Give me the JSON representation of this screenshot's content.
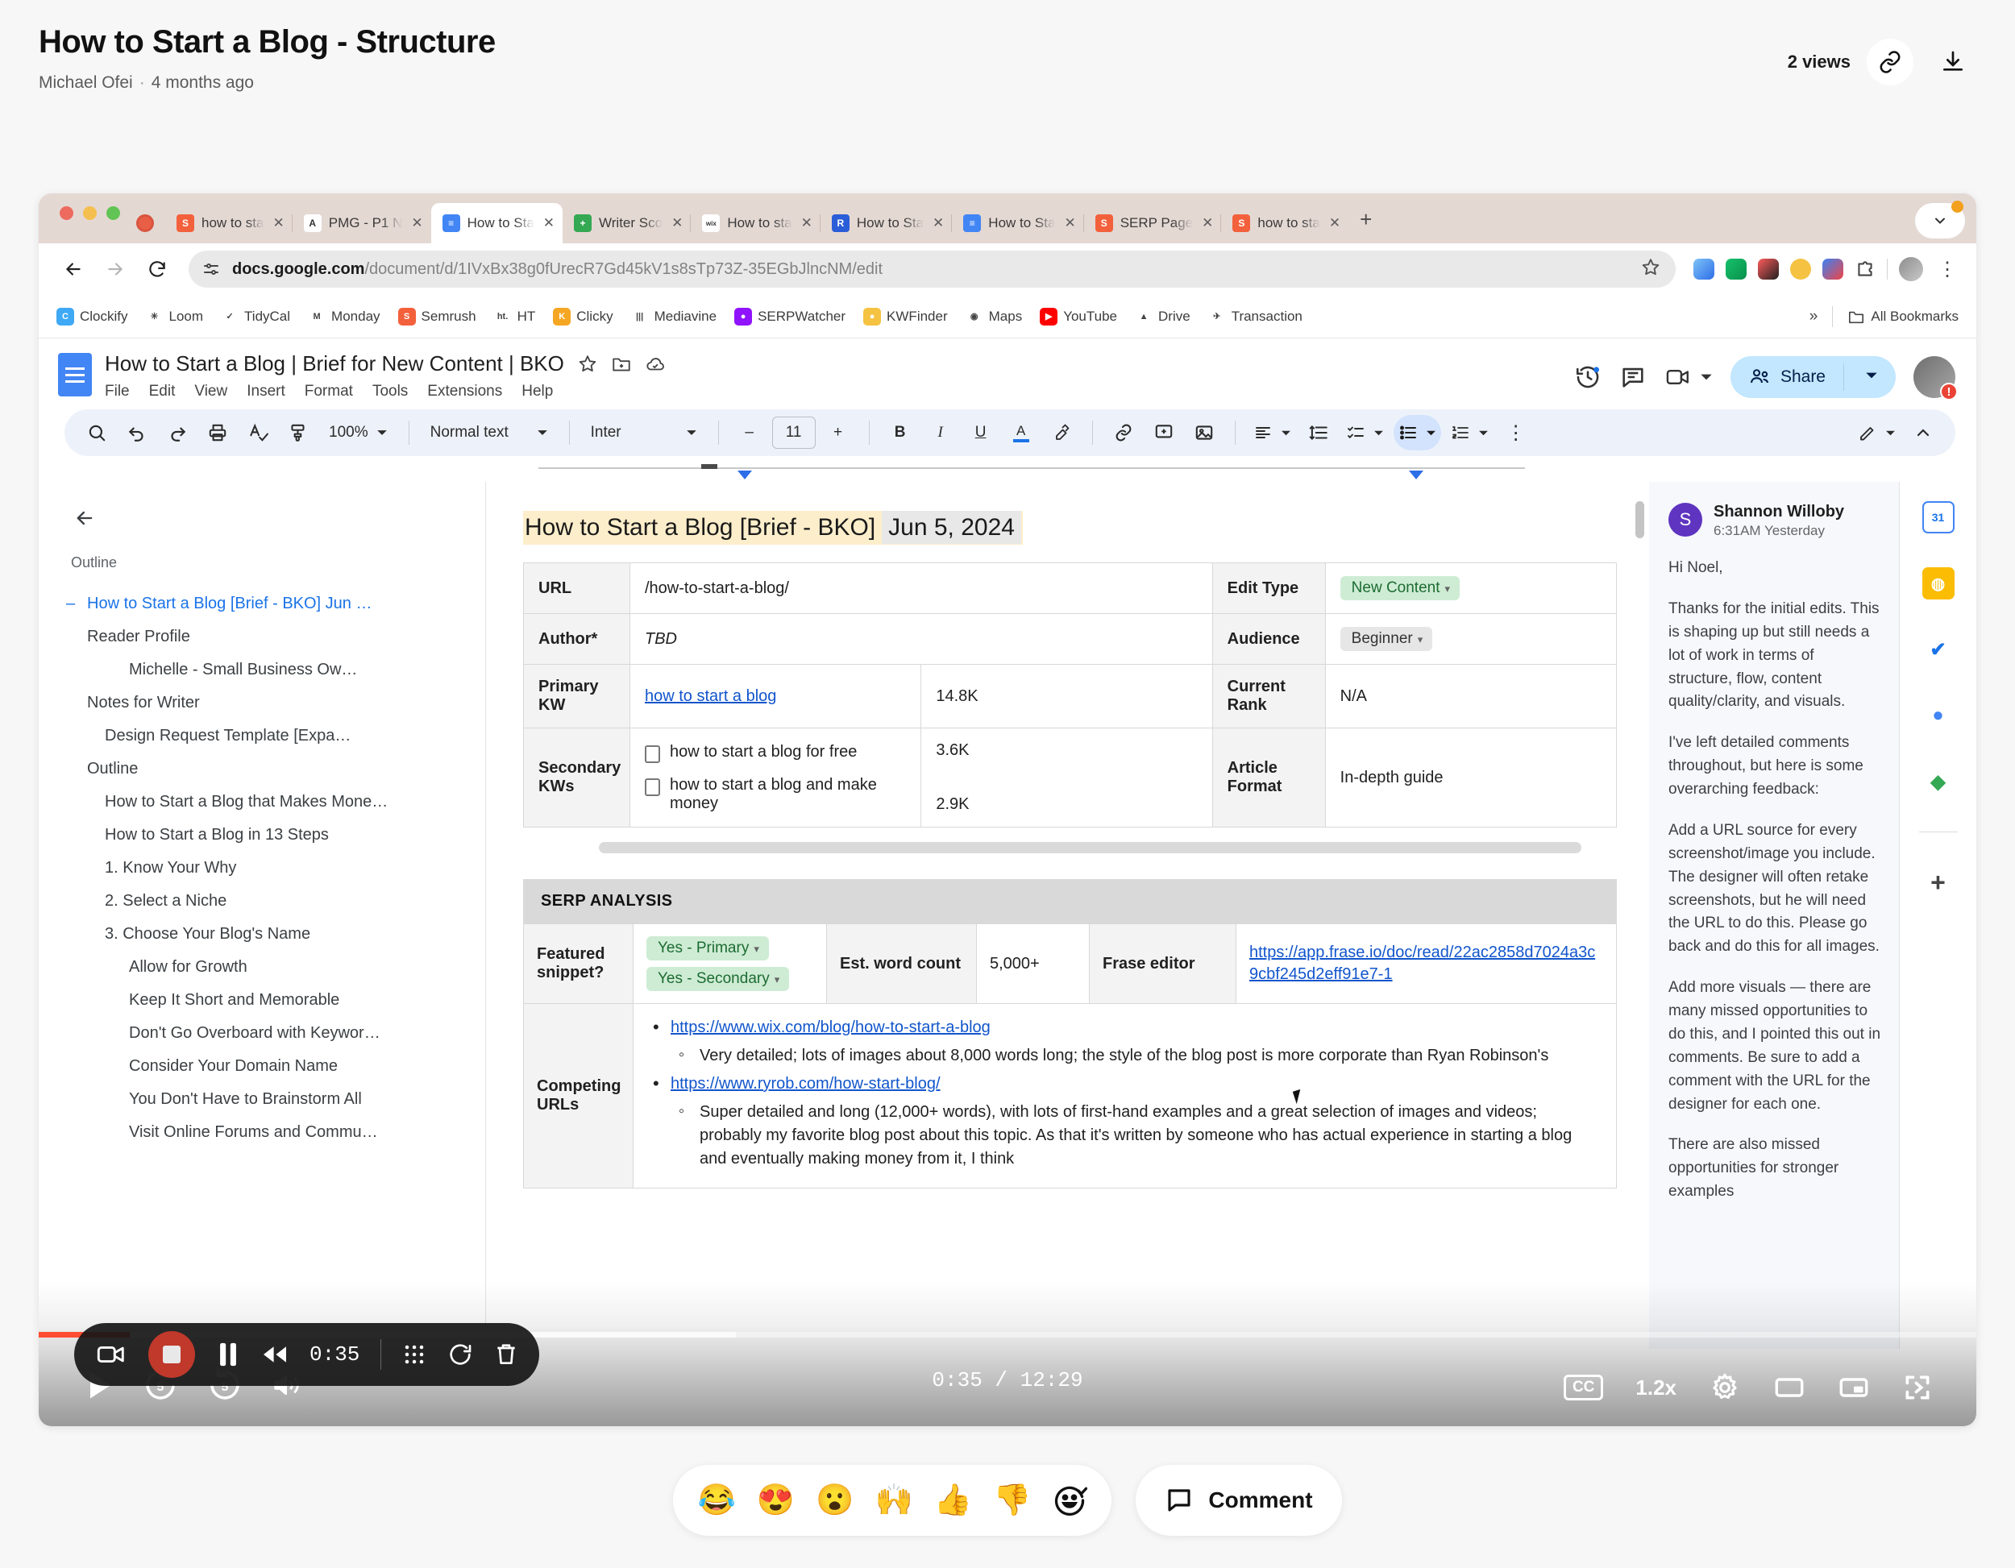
{
  "page": {
    "title": "How to Start a Blog - Structure",
    "author": "Michael Ofei",
    "separator": "·",
    "age": "4 months ago",
    "views": "2 views"
  },
  "browser": {
    "tabs": [
      {
        "label": "how to sta",
        "favicon": "semrush-icon",
        "color": "#f3603c",
        "glyph": "S",
        "active": false
      },
      {
        "label": "PMG - P1 N",
        "favicon": "analytics-icon",
        "color": "#ffffff",
        "glyph": "A",
        "active": false
      },
      {
        "label": "How to Sta",
        "favicon": "google-docs-icon",
        "color": "#4285f4",
        "glyph": "≡",
        "active": true
      },
      {
        "label": "Writer Sco",
        "favicon": "writer-icon",
        "color": "#34a853",
        "glyph": "+",
        "active": false
      },
      {
        "label": "How to sta",
        "favicon": "wix-icon",
        "color": "#ffffff",
        "glyph": "wix",
        "active": false
      },
      {
        "label": "How to Sta",
        "favicon": "reader-icon",
        "color": "#2b5dd8",
        "glyph": "R",
        "active": false
      },
      {
        "label": "How to Sta",
        "favicon": "google-docs-icon",
        "color": "#4285f4",
        "glyph": "≡",
        "active": false
      },
      {
        "label": "SERP Page",
        "favicon": "semrush-icon",
        "color": "#f3603c",
        "glyph": "S",
        "active": false
      },
      {
        "label": "how to sta",
        "favicon": "semrush-icon",
        "color": "#f3603c",
        "glyph": "S",
        "active": false
      }
    ],
    "new_tab_label": "+",
    "close_label": "✕",
    "url_bold": "docs.google.com",
    "url_rest": "/document/d/1IVxBx38g0fUrecR7Gd45kV1s8sTp73Z-35EGbJlncNM/edit",
    "bookmarks": [
      {
        "label": "Clockify",
        "color": "#3fa9f5",
        "glyph": "C"
      },
      {
        "label": "Loom",
        "color": "#ffffff",
        "glyph": "✳"
      },
      {
        "label": "TidyCal",
        "color": "#ffffff",
        "glyph": "✓"
      },
      {
        "label": "Monday",
        "color": "#ffffff",
        "glyph": "M"
      },
      {
        "label": "Semrush",
        "color": "#f3603c",
        "glyph": "S"
      },
      {
        "label": "HT",
        "color": "#ffffff",
        "glyph": "ht."
      },
      {
        "label": "Clicky",
        "color": "#f5a623",
        "glyph": "K"
      },
      {
        "label": "Mediavine",
        "color": "#ffffff",
        "glyph": "|||"
      },
      {
        "label": "SERPWatcher",
        "color": "#9013fe",
        "glyph": "●"
      },
      {
        "label": "KWFinder",
        "color": "#f5c242",
        "glyph": "●"
      },
      {
        "label": "Maps",
        "color": "#ffffff",
        "glyph": "◉"
      },
      {
        "label": "YouTube",
        "color": "#ff0000",
        "glyph": "▶"
      },
      {
        "label": "Drive",
        "color": "#ffffff",
        "glyph": "▲"
      },
      {
        "label": "Transaction",
        "color": "#ffffff",
        "glyph": "✈"
      }
    ],
    "overflow_label": "»",
    "all_bookmarks_label": "All Bookmarks"
  },
  "docs": {
    "doc_title": "How to Start a Blog | Brief for New Content | BKO",
    "menu": [
      "File",
      "Edit",
      "View",
      "Insert",
      "Format",
      "Tools",
      "Extensions",
      "Help"
    ],
    "share_label": "Share",
    "toolbar": {
      "zoom": "100%",
      "style": "Normal text",
      "font": "Inter",
      "font_size": "11",
      "minus": "–",
      "plus": "+",
      "bold": "B",
      "italic": "I",
      "underline": "U",
      "text_color": "A",
      "more": "⋮"
    }
  },
  "outline": {
    "header_label": "Outline",
    "items": [
      {
        "label": "How to Start a Blog [Brief - BKO] Jun …",
        "level": 0,
        "active": true
      },
      {
        "label": "Reader Profile",
        "level": 1,
        "active": false
      },
      {
        "label": "Michelle - Small Business Ow…",
        "level": 3,
        "active": false
      },
      {
        "label": "Notes for Writer",
        "level": 1,
        "active": false
      },
      {
        "label": "Design Request Template [Expa…",
        "level": 2,
        "active": false
      },
      {
        "label": "Outline",
        "level": 1,
        "active": false
      },
      {
        "label": "How to Start a Blog that Makes Mone…",
        "level": 2,
        "active": false
      },
      {
        "label": "How to Start a Blog in 13 Steps",
        "level": 2,
        "active": false
      },
      {
        "label": "1. Know Your Why",
        "level": 2,
        "active": false
      },
      {
        "label": "2. Select a Niche",
        "level": 2,
        "active": false
      },
      {
        "label": "3. Choose Your Blog's Name",
        "level": 2,
        "active": false
      },
      {
        "label": "Allow for Growth",
        "level": 3,
        "active": false
      },
      {
        "label": "Keep It Short and Memorable",
        "level": 3,
        "active": false
      },
      {
        "label": "Don't Go Overboard with Keywor…",
        "level": 3,
        "active": false
      },
      {
        "label": "Consider Your Domain Name",
        "level": 3,
        "active": false
      },
      {
        "label": "You Don't Have to Brainstorm All",
        "level": 3,
        "active": false
      },
      {
        "label": "Visit Online Forums and Commu…",
        "level": 3,
        "active": false
      }
    ]
  },
  "document": {
    "heading": "How to Start a Blog [Brief - BKO]",
    "heading_date": "Jun 5, 2024",
    "brief_rows": [
      {
        "label": "URL",
        "value": "/how-to-start-a-blog/",
        "label2": "Edit Type",
        "value2": "New Content",
        "chip2": "green"
      },
      {
        "label": "Author*",
        "value": "TBD",
        "label2": "Audience",
        "value2": "Beginner",
        "chip2": "grey"
      }
    ],
    "primary_kw_label": "Primary KW",
    "primary_kw": "how to start a blog",
    "primary_kw_volume": "14.8K",
    "current_rank_label": "Current Rank",
    "current_rank": "N/A",
    "secondary_kw_label": "Secondary KWs",
    "secondary_kws": [
      {
        "text": "how to start a blog for free",
        "volume": "3.6K"
      },
      {
        "text": "how to start a blog and make money",
        "volume": "2.9K"
      }
    ],
    "article_format_label": "Article Format",
    "article_format": "In-depth guide",
    "serp_section_title": "SERP ANALYSIS",
    "featured_snippet_label": "Featured snippet?",
    "featured_snippet_values": [
      "Yes - Primary",
      "Yes - Secondary"
    ],
    "est_word_count_label": "Est. word count",
    "est_word_count": "5,000+",
    "frase_editor_label": "Frase editor",
    "frase_url": "https://app.frase.io/doc/read/22ac2858d7024a3c9cbf245d2eff91e7-1",
    "competing_urls_label": "Competing URLs",
    "competing": [
      {
        "url": "https://www.wix.com/blog/how-to-start-a-blog",
        "note": "Very detailed; lots of images about 8,000 words long; the style of the blog post is more corporate than Ryan Robinson's"
      },
      {
        "url": "https://www.ryrob.com/how-start-blog/",
        "note": "Super detailed and long (12,000+ words), with lots of first-hand examples and a great selection of images and videos; probably my favorite blog post about this topic. As that it's written by someone who has actual experience in starting a blog and eventually making money from it, I think"
      }
    ]
  },
  "comment": {
    "avatar_initial": "S",
    "author": "Shannon Willoby",
    "time": "6:31AM Yesterday",
    "paragraphs": [
      "Hi Noel,",
      "Thanks for the initial edits. This is shaping up but still needs a lot of work in terms of structure, flow, content quality/clarity, and visuals.",
      "I've left detailed comments throughout, but here is some overarching feedback:",
      "Add a URL source for every screenshot/image you include. The designer will often retake screenshots, but he will need the URL to do this. Please go back and do this for all images.",
      "Add more visuals — there are many missed opportunities to do this, and I pointed this out in comments. Be sure to add a comment with the URL for the designer for each one.",
      "There are also missed opportunities for stronger examples"
    ]
  },
  "rail": {
    "items": [
      {
        "name": "google-calendar-icon",
        "glyph": "31",
        "color": "#ffffff"
      },
      {
        "name": "google-keep-icon",
        "glyph": "◍",
        "color": "#fbbc04"
      },
      {
        "name": "google-tasks-icon",
        "glyph": "✓",
        "color": "#ffffff"
      },
      {
        "name": "google-contacts-icon",
        "glyph": "●",
        "color": "#ffffff"
      },
      {
        "name": "google-maps-icon",
        "glyph": "◆",
        "color": "#ffffff"
      }
    ],
    "add_label": "+"
  },
  "player": {
    "recorder_time": "0:35",
    "timecode_current": "0:35",
    "timecode_total": "12:29",
    "timecode_display": "0:35 / 12:29",
    "skip_back_label": "5",
    "skip_fwd_label": "5",
    "cc_label": "CC",
    "speed": "1.2x",
    "progress_percent": 4.7,
    "buffered_percent": 36
  },
  "reactions": {
    "emojis": [
      "😂",
      "😍",
      "😮",
      "🙌",
      "👍",
      "👎"
    ],
    "add_reaction_name": "add-reaction-icon",
    "comment_label": "Comment"
  },
  "colors": {
    "accent_blue": "#1a73e8",
    "share_blue": "#c2e7ff",
    "progress_red": "#ff4d31",
    "chip_green": "#ceecd4",
    "highlight_yellow": "#fdeecb"
  }
}
